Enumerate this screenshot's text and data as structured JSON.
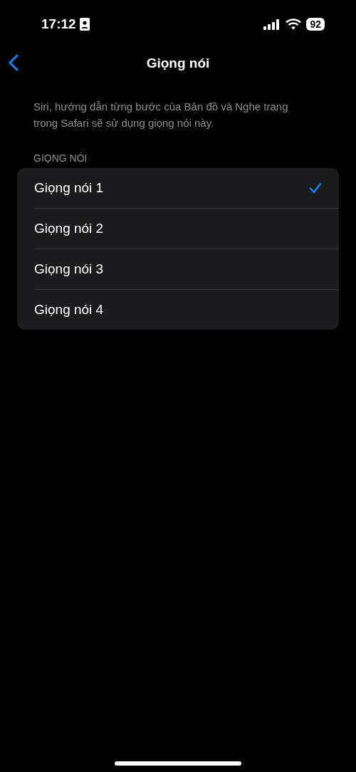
{
  "status_bar": {
    "time": "17:12",
    "battery": "92"
  },
  "nav": {
    "title": "Giọng nói"
  },
  "description": "Siri, hướng dẫn từng bước của Bản đồ và Nghe trang trong Safari sẽ sử dụng giọng nói này.",
  "section": {
    "header": "GIỌNG NÓI",
    "items": [
      {
        "label": "Giọng nói 1",
        "selected": true
      },
      {
        "label": "Giọng nói 2",
        "selected": false
      },
      {
        "label": "Giọng nói 3",
        "selected": false
      },
      {
        "label": "Giọng nói 4",
        "selected": false
      }
    ]
  }
}
